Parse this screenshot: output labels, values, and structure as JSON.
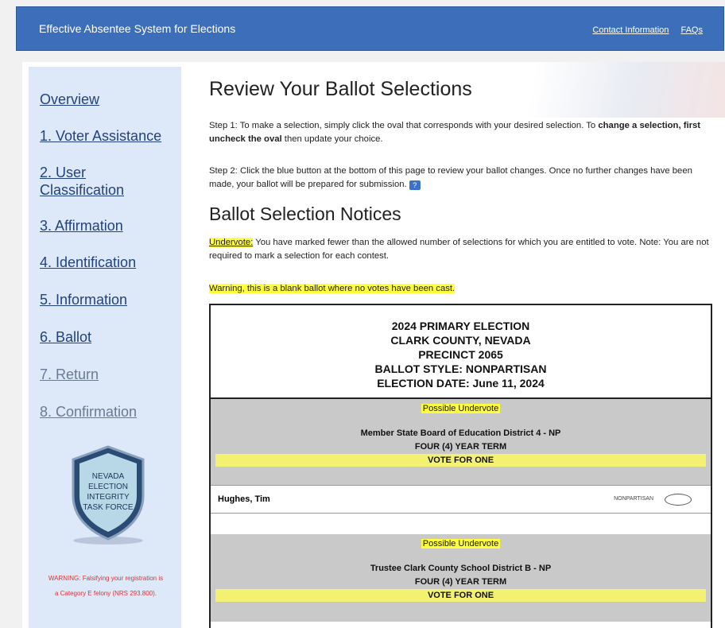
{
  "header": {
    "title": "Effective Absentee System for Elections",
    "contact_link": "Contact Information",
    "faqs_link": "FAQs"
  },
  "sidebar": {
    "items": [
      {
        "label": "Overview"
      },
      {
        "label": "1. Voter Assistance"
      },
      {
        "label": "2. User Classification"
      },
      {
        "label": "3. Affirmation"
      },
      {
        "label": "4. Identification"
      },
      {
        "label": "5. Information"
      },
      {
        "label": "6. Ballot"
      },
      {
        "label": "7. Return"
      },
      {
        "label": "8. Confirmation"
      }
    ],
    "badge": {
      "line1": "NEVADA",
      "line2": "ELECTION",
      "line3": "INTEGRITY",
      "line4": "TASK FORCE"
    },
    "warning": "WARNING: Falsifying your registration is a Category E felony (NRS 293.800)."
  },
  "main": {
    "title": "Review Your Ballot Selections",
    "step1_text": "Step 1:  To make a selection, simply click the oval that corresponds with your desired selection. To ",
    "step1_bold": "change a selection, first uncheck the oval",
    "step1_end": " then update your choice.",
    "step2": "Step 2:  Click the blue button at the bottom of this page to review your ballot changes. Once no further changes have been made, your ballot will be prepared for submission.",
    "help_icon": "?",
    "notices_title": "Ballot Selection Notices",
    "undervote_label": "Undervote:",
    "undervote_text": " You have marked fewer than the allowed number of selections for which you are entitled to vote. Note: You are not required to mark a selection for each contest.",
    "blank_warning": "Warning, this is a blank ballot where no votes have been cast."
  },
  "ballot": {
    "header": {
      "line1": "2024 PRIMARY ELECTION",
      "line2": "CLARK COUNTY, NEVADA",
      "line3": "PRECINCT 2065",
      "line4": "BALLOT STYLE: NONPARTISAN",
      "line5": "ELECTION DATE: June 11, 2024"
    },
    "contests": [
      {
        "undervote": "Possible Undervote",
        "title": "Member State Board of Education District 4 - NP",
        "term": "FOUR (4) YEAR TERM",
        "vote_for": "VOTE FOR ONE",
        "candidates": [
          {
            "name": "Hughes, Tim",
            "party": "NONPARTISAN"
          }
        ]
      },
      {
        "undervote": "Possible Undervote",
        "title": "Trustee Clark County School District B - NP",
        "term": "FOUR (4) YEAR TERM",
        "vote_for": "VOTE FOR ONE"
      }
    ]
  },
  "colors": {
    "header_bg": "#3d6eb9",
    "sidebar_bg": "#dde8f8",
    "highlight": "#ffff3b",
    "contest_bg": "#c9c9c9",
    "warning_text": "#dd3333"
  }
}
